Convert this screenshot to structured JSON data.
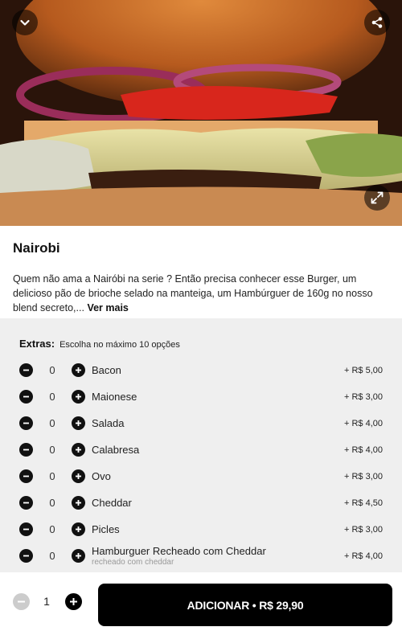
{
  "product": {
    "name": "Nairobi",
    "description": "Quem não ama a Nairóbi na serie ? Então precisa conhecer esse Burger, um delicioso pão de brioche selado na manteiga, um Hambúrguer de 160g no nosso blend secreto,...",
    "more_label": "Ver mais"
  },
  "extras": {
    "label": "Extras:",
    "hint": "Escolha no máximo 10 opções",
    "items": [
      {
        "qty": "0",
        "name": "Bacon",
        "sub": "",
        "price": "+ R$ 5,00"
      },
      {
        "qty": "0",
        "name": "Maionese",
        "sub": "",
        "price": "+ R$ 3,00"
      },
      {
        "qty": "0",
        "name": "Salada",
        "sub": "",
        "price": "+ R$ 4,00"
      },
      {
        "qty": "0",
        "name": "Calabresa",
        "sub": "",
        "price": "+ R$ 4,00"
      },
      {
        "qty": "0",
        "name": "Ovo",
        "sub": "",
        "price": "+ R$ 3,00"
      },
      {
        "qty": "0",
        "name": "Cheddar",
        "sub": "",
        "price": "+ R$ 4,50"
      },
      {
        "qty": "0",
        "name": "Picles",
        "sub": "",
        "price": "+ R$ 3,00"
      },
      {
        "qty": "0",
        "name": "Hamburguer Recheado com Cheddar",
        "sub": "recheado com cheddar",
        "price": "+ R$ 4,00"
      }
    ]
  },
  "cart": {
    "qty": "1",
    "add_label": "ADICIONAR • R$ 29,90"
  },
  "icons": {
    "back": "chevron-down-icon",
    "share": "share-icon",
    "expand": "expand-icon",
    "minus": "minus-icon",
    "plus": "plus-icon"
  },
  "colors": {
    "button": "#000000",
    "extras_bg": "#efefef",
    "minus_disabled": "#cccccc"
  }
}
